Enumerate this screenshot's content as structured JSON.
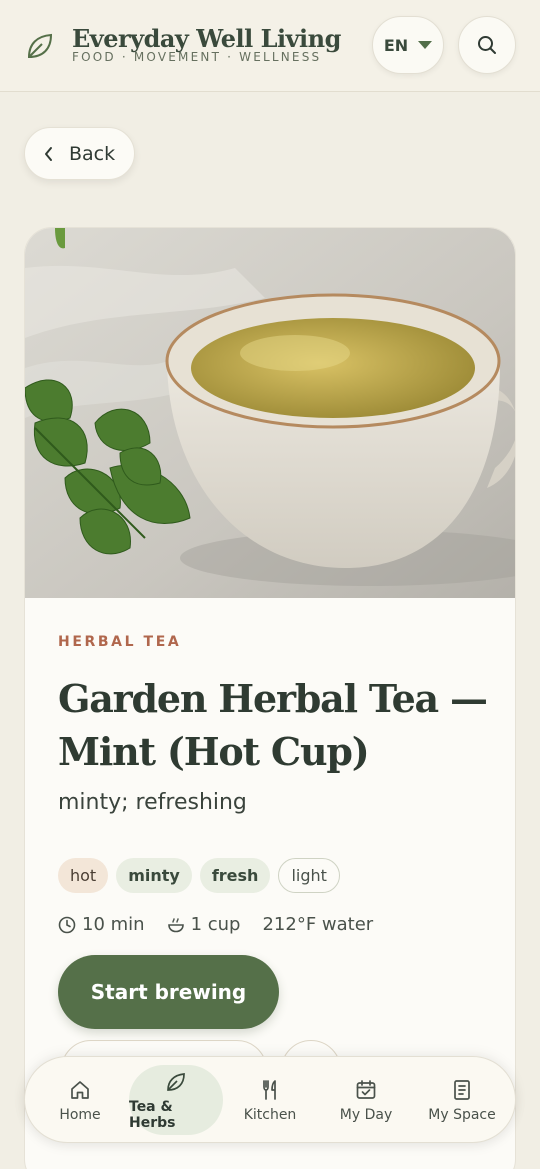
{
  "colors": {
    "accent": "#557049",
    "category": "#b0674d",
    "background": "#f1eee4",
    "card": "#fcfbf7"
  },
  "header": {
    "brand_icon": "leaf-icon",
    "brand_title": "Everyday Well Living",
    "brand_tagline": "FOOD · MOVEMENT · WELLNESS",
    "language": "EN",
    "search_icon": "search-icon"
  },
  "back": {
    "label": "Back",
    "icon": "chevron-left-icon"
  },
  "recipe": {
    "category": "HERBAL TEA",
    "title": "Garden Herbal Tea — Mint (Hot Cup)",
    "subtitle": "minty; refreshing",
    "tags": [
      "hot",
      "minty",
      "fresh",
      "light"
    ],
    "meta": {
      "time": "10 min",
      "yield": "1 cup",
      "water": "212°F water"
    },
    "primary_action": "Start brewing"
  },
  "bottom_nav": {
    "items": [
      {
        "label": "Home",
        "icon": "home-icon"
      },
      {
        "label": "Tea & Herbs",
        "icon": "leaf-icon",
        "active": true
      },
      {
        "label": "Kitchen",
        "icon": "utensils-icon"
      },
      {
        "label": "My Day",
        "icon": "calendar-check-icon"
      },
      {
        "label": "My Space",
        "icon": "notebook-icon"
      }
    ]
  }
}
